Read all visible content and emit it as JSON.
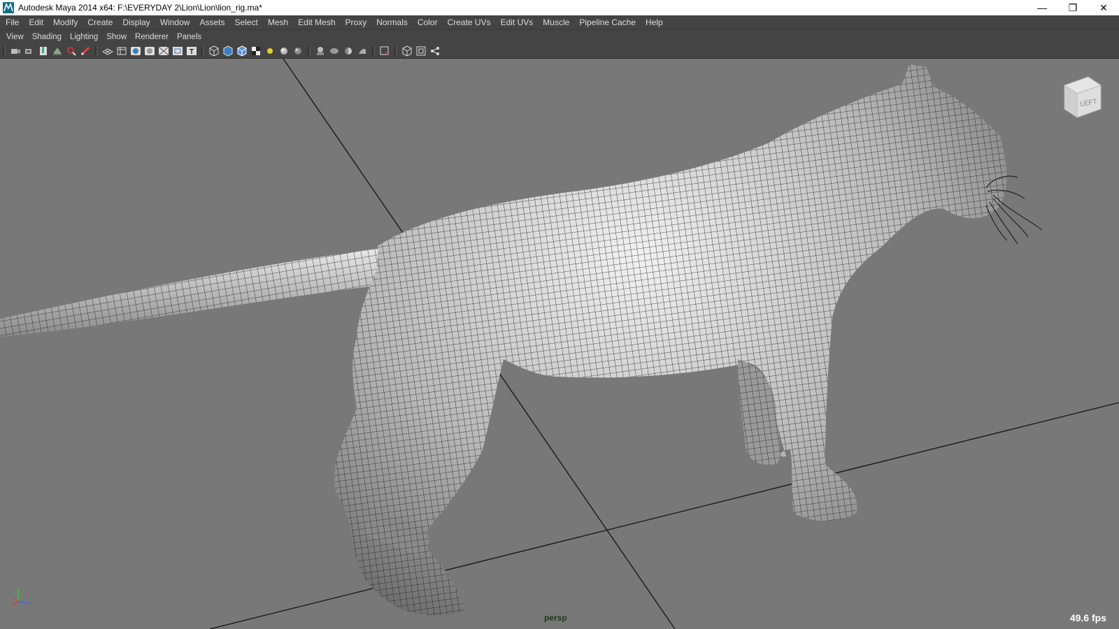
{
  "window": {
    "title": "Autodesk Maya 2014 x64: F:\\EVERYDAY 2\\Lion\\Lion\\lion_rig.ma*",
    "minimize_glyph": "—",
    "restore_glyph": "❐",
    "close_glyph": "✕"
  },
  "menubar": {
    "items": [
      "File",
      "Edit",
      "Modify",
      "Create",
      "Display",
      "Window",
      "Assets",
      "Select",
      "Mesh",
      "Edit Mesh",
      "Proxy",
      "Normals",
      "Color",
      "Create UVs",
      "Edit UVs",
      "Muscle",
      "Pipeline Cache",
      "Help"
    ]
  },
  "panelmenu": {
    "items": [
      "View",
      "Shading",
      "Lighting",
      "Show",
      "Renderer",
      "Panels"
    ]
  },
  "toolbar": {
    "icons": [
      "select-camera-icon",
      "camera-attributes-icon",
      "bookmarks-icon",
      "image-plane-icon",
      "two-d-pan-zoom-icon",
      "grease-pencil-icon",
      "grid-icon",
      "film-gate-icon",
      "resolution-gate-icon",
      "gate-mask-icon",
      "field-chart-icon",
      "safe-action-icon",
      "safe-title-icon",
      "wireframe-icon",
      "smooth-shade-icon",
      "wireframe-on-shaded-icon",
      "textured-icon",
      "use-lights-icon",
      "shadows-icon",
      "screen-space-ao-icon",
      "motion-blur-icon",
      "multisample-aa-icon",
      "depth-of-field-icon",
      "isolate-select-icon",
      "xray-icon",
      "xray-joints-icon",
      "xray-components-icon"
    ]
  },
  "viewport": {
    "camera_label": "persp",
    "fps": "49.6 fps",
    "viewcube_face": "LEFT",
    "background_color": "#787878",
    "grid_line_color": "#1a1a1a",
    "mesh_color": "#c9c9c9",
    "wire_color": "#1e1e1e"
  }
}
